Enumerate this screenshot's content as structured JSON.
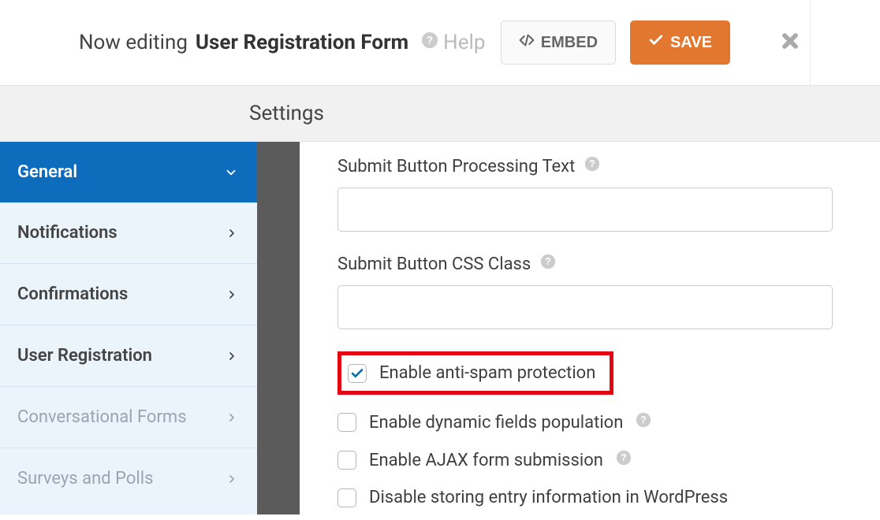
{
  "header": {
    "prefix": "Now editing",
    "title": "User Registration Form",
    "help_label": "Help",
    "embed_label": "EMBED",
    "save_label": "SAVE"
  },
  "settings_title": "Settings",
  "sidebar": {
    "items": [
      {
        "label": "General",
        "active": true,
        "disabled": false,
        "expanded": true
      },
      {
        "label": "Notifications",
        "active": false,
        "disabled": false,
        "expanded": false
      },
      {
        "label": "Confirmations",
        "active": false,
        "disabled": false,
        "expanded": false
      },
      {
        "label": "User Registration",
        "active": false,
        "disabled": false,
        "expanded": false
      },
      {
        "label": "Conversational Forms",
        "active": false,
        "disabled": true,
        "expanded": false
      },
      {
        "label": "Surveys and Polls",
        "active": false,
        "disabled": true,
        "expanded": false
      }
    ]
  },
  "form": {
    "submit_processing_label": "Submit Button Processing Text",
    "submit_processing_value": "",
    "submit_css_label": "Submit Button CSS Class",
    "submit_css_value": "",
    "checkboxes": [
      {
        "label": "Enable anti-spam protection",
        "checked": true,
        "highlight": true,
        "help": false
      },
      {
        "label": "Enable dynamic fields population",
        "checked": false,
        "highlight": false,
        "help": true
      },
      {
        "label": "Enable AJAX form submission",
        "checked": false,
        "highlight": false,
        "help": true
      },
      {
        "label": "Disable storing entry information in WordPress",
        "checked": false,
        "highlight": false,
        "help": false
      }
    ]
  }
}
